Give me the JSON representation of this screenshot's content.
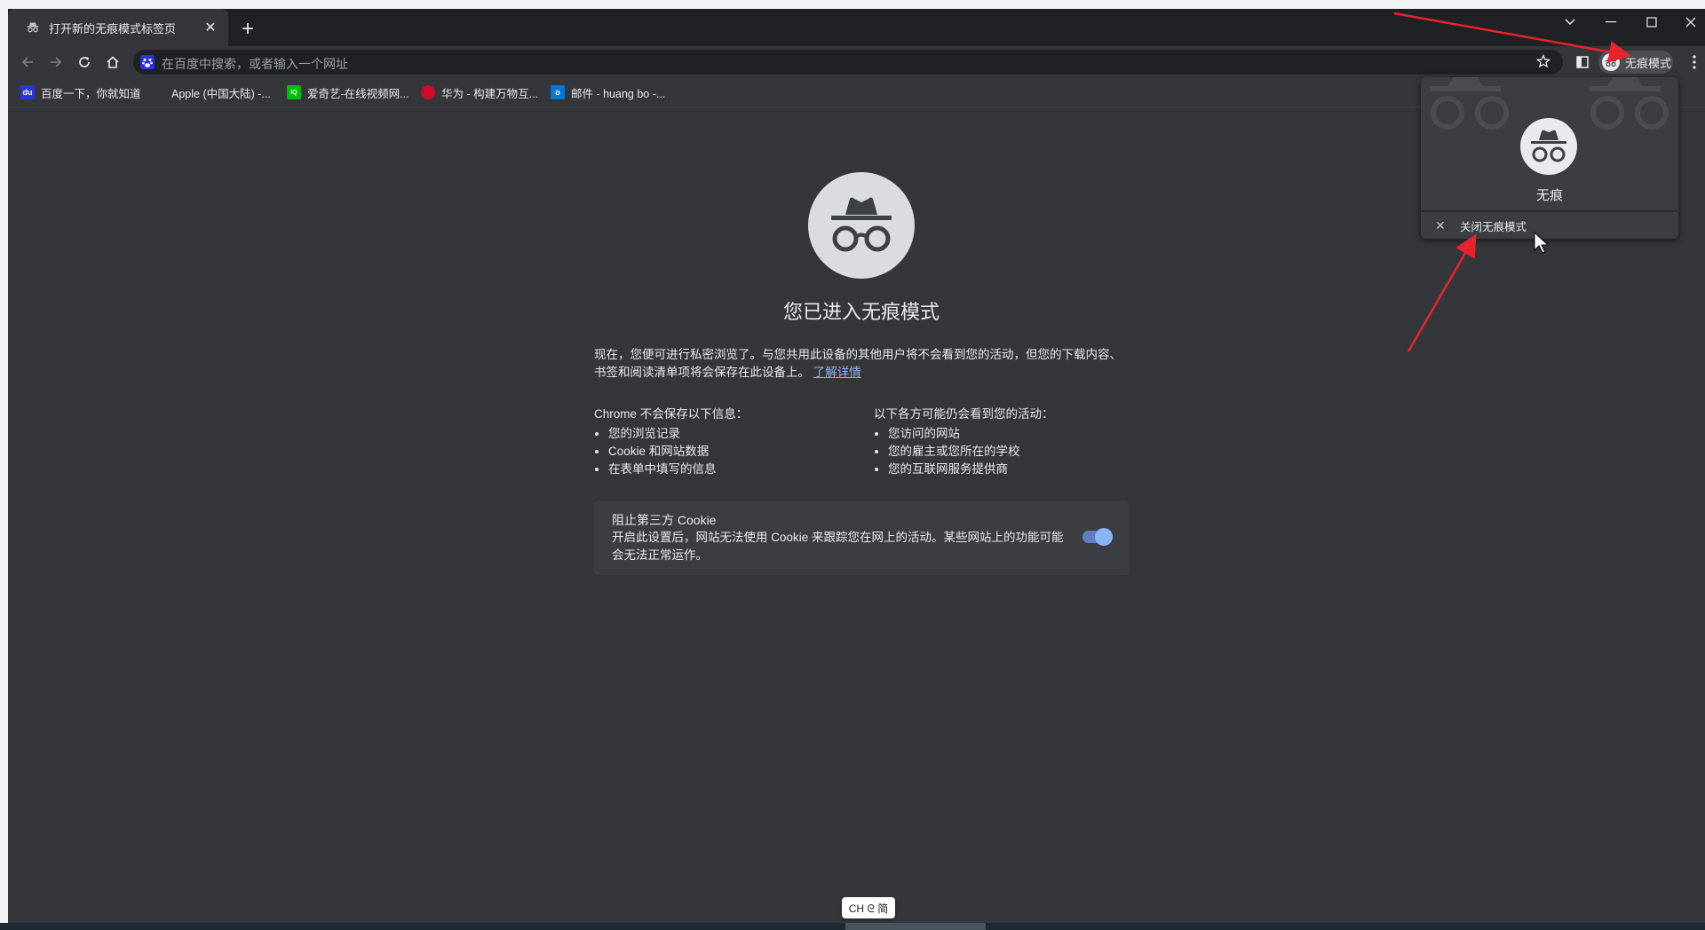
{
  "tab": {
    "title": "打开新的无痕模式标签页",
    "icon": "incognito-icon"
  },
  "omnibox": {
    "placeholder": "在百度中搜索，或者输入一个网址"
  },
  "profile_chip": {
    "label": "无痕模式"
  },
  "bookmarks": [
    {
      "label": "百度一下，你就知道",
      "icon": "baidu-icon",
      "color": "#2932e1"
    },
    {
      "label": "Apple (中国大陆) -...",
      "icon": "apple-icon",
      "color": "#e8eaed"
    },
    {
      "label": "爱奇艺-在线视频网...",
      "icon": "iqiyi-icon",
      "color": "#00be06"
    },
    {
      "label": "华为 - 构建万物互...",
      "icon": "huawei-icon",
      "color": "#cf0a2c"
    },
    {
      "label": "邮件 - huang bo -...",
      "icon": "outlook-icon",
      "color": "#0078d4"
    }
  ],
  "main": {
    "title": "您已进入无痕模式",
    "intro": "现在，您便可进行私密浏览了。与您共用此设备的其他用户将不会看到您的活动，但您的下载内容、书签和阅读清单项将会保存在此设备上。",
    "learn_more": "了解详情",
    "not_saved_heading": "Chrome 不会保存以下信息：",
    "not_saved": [
      "您的浏览记录",
      "Cookie 和网站数据",
      "在表单中填写的信息"
    ],
    "visible_heading": "以下各方可能仍会看到您的活动：",
    "visible": [
      "您访问的网站",
      "您的雇主或您所在的学校",
      "您的互联网服务提供商"
    ]
  },
  "cookie_card": {
    "title": "阻止第三方 Cookie",
    "description": "开启此设置后，网站无法使用 Cookie 来跟踪您在网上的活动。某些网站上的功能可能会无法正常运作。",
    "enabled": true
  },
  "profile_popup": {
    "name": "无痕",
    "exit_label": "关闭无痕模式"
  },
  "ime": {
    "label": "CH ᘓ 简"
  },
  "colors": {
    "background": "#35363a",
    "titlebar": "#202124",
    "accent": "#8ab4f8",
    "annotation": "#e8232b"
  }
}
